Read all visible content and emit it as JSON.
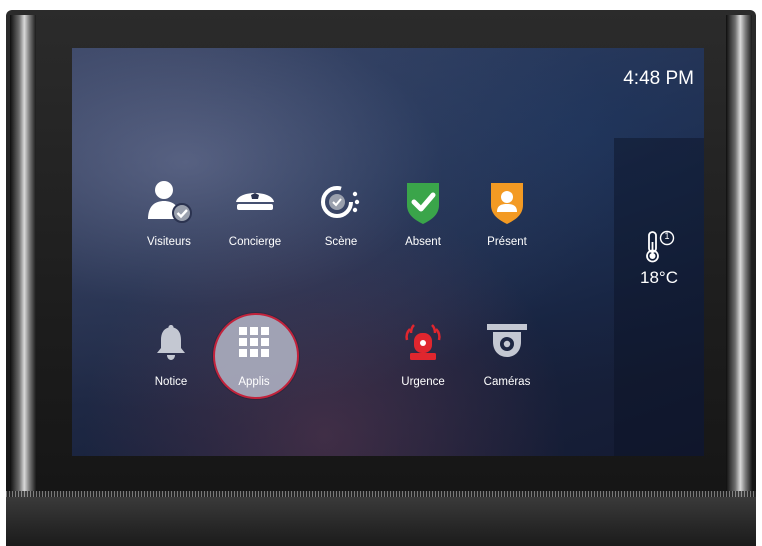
{
  "status": {
    "time": "4:48 PM"
  },
  "weather": {
    "temperature": "18",
    "unit": "°C",
    "badge": "1"
  },
  "apps_row1": [
    {
      "label": "Visiteurs",
      "icon": "visitor-icon"
    },
    {
      "label": "Concierge",
      "icon": "concierge-icon"
    },
    {
      "label": "Scène",
      "icon": "scene-icon"
    },
    {
      "label": "Absent",
      "icon": "shield-check-icon"
    },
    {
      "label": "Présent",
      "icon": "shield-person-icon"
    }
  ],
  "apps_row2": [
    {
      "label": "Notice",
      "icon": "bell-icon"
    },
    {
      "label": "Applis",
      "icon": "grid-icon",
      "selected": true
    },
    {
      "label": "Urgence",
      "icon": "alarm-icon"
    },
    {
      "label": "Caméras",
      "icon": "camera-icon"
    }
  ],
  "colors": {
    "absent_shield": "#3aa54a",
    "present_shield": "#f39a23",
    "urgence": "#e0262e",
    "selection_ring": "#c2223b"
  }
}
